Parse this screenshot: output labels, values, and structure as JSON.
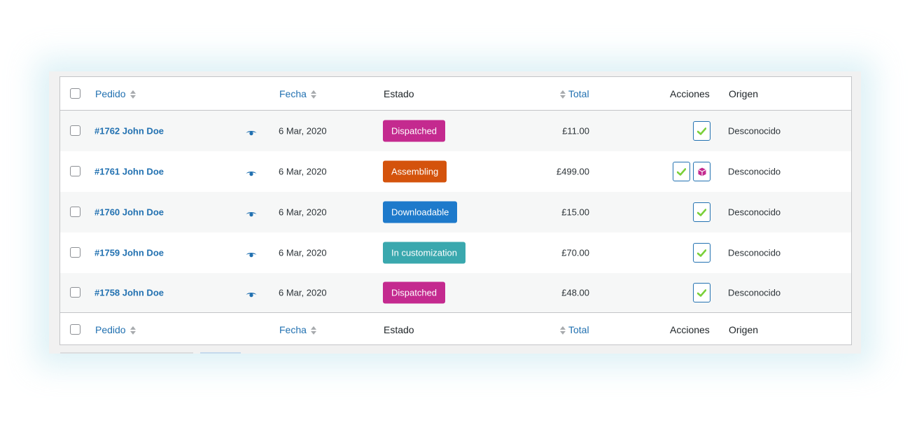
{
  "columns": {
    "order": "Pedido",
    "date": "Fecha",
    "status": "Estado",
    "total": "Total",
    "actions": "Acciones",
    "origin": "Origen"
  },
  "orders": [
    {
      "label": "#1762 John Doe",
      "date": "6 Mar, 2020",
      "status": "Dispatched",
      "status_color": "#c42a8f",
      "total": "£11.00",
      "actions": [
        "complete"
      ],
      "origin": "Desconocido"
    },
    {
      "label": "#1761 John Doe",
      "date": "6 Mar, 2020",
      "status": "Assembling",
      "status_color": "#d4530c",
      "total": "£499.00",
      "actions": [
        "complete",
        "package"
      ],
      "origin": "Desconocido"
    },
    {
      "label": "#1760 John Doe",
      "date": "6 Mar, 2020",
      "status": "Downloadable",
      "status_color": "#1e7acb",
      "total": "£15.00",
      "actions": [
        "complete"
      ],
      "origin": "Desconocido"
    },
    {
      "label": "#1759 John Doe",
      "date": "6 Mar, 2020",
      "status": "In customization",
      "status_color": "#3aa8ae",
      "total": "£70.00",
      "actions": [
        "complete"
      ],
      "origin": "Desconocido"
    },
    {
      "label": "#1758 John Doe",
      "date": "6 Mar, 2020",
      "status": "Dispatched",
      "status_color": "#c42a8f",
      "total": "£48.00",
      "actions": [
        "complete"
      ],
      "origin": "Desconocido"
    }
  ],
  "icons": {
    "preview": "eye-icon",
    "complete": "checkmark-icon",
    "package": "cube-icon"
  },
  "colors": {
    "link": "#2271b1",
    "check": "#7ad03a",
    "package": "#c42a8f"
  }
}
